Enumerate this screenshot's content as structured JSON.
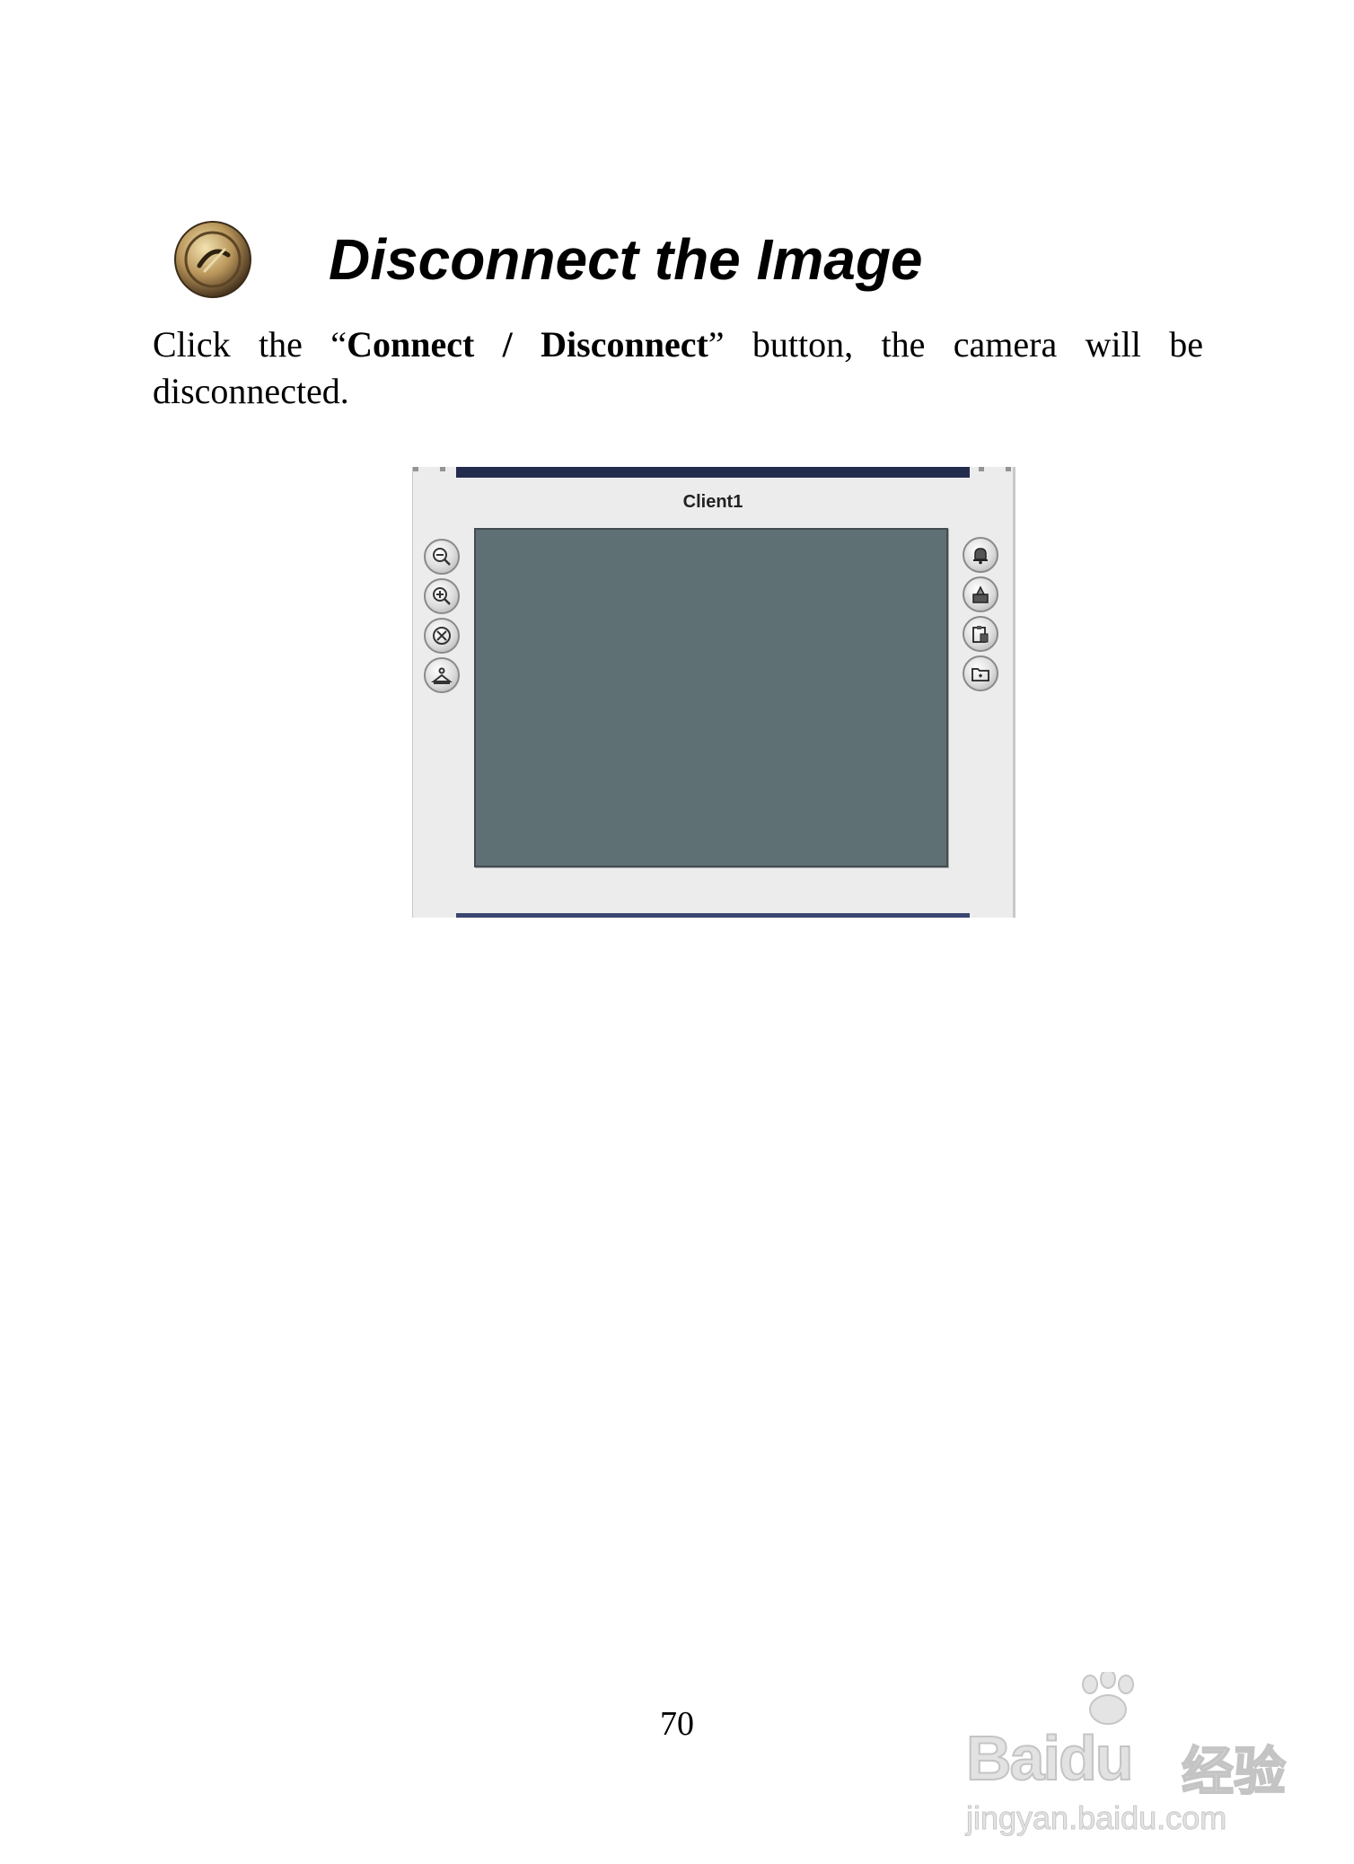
{
  "heading": {
    "title": "Disconnect the Image",
    "icon": "connect-disconnect-icon"
  },
  "instruction": {
    "before": "Click the “",
    "bold": "Connect / Disconnect",
    "after": "” button, the camera will be disconnected."
  },
  "viewer": {
    "client_label": "Client1",
    "video_bg_color": "#5f7074",
    "left_tools": [
      {
        "icon": "zoom-out-icon"
      },
      {
        "icon": "zoom-in-icon"
      },
      {
        "icon": "connect-disconnect-icon"
      },
      {
        "icon": "record-icon"
      }
    ],
    "right_tools": [
      {
        "icon": "alarm-bell-icon"
      },
      {
        "icon": "snapshot-icon"
      },
      {
        "icon": "clipboard-icon"
      },
      {
        "icon": "folder-icon"
      }
    ]
  },
  "page_number": "70",
  "watermark": {
    "brand": "Bai",
    "brand_suffix": "du",
    "cn": "经验",
    "url": "jingyan.baidu.com"
  }
}
